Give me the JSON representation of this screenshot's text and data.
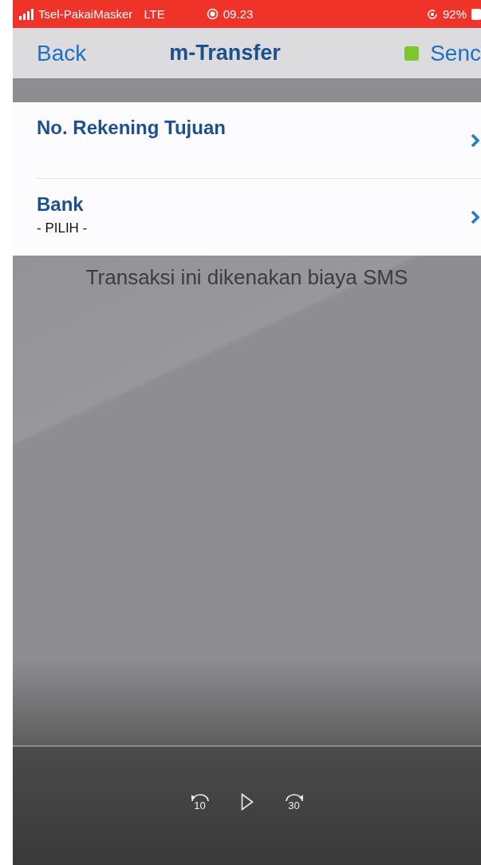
{
  "status_bar": {
    "carrier": "Tsel-PakaiMasker",
    "network": "LTE",
    "recording": true,
    "time": "09.23",
    "battery": "92%"
  },
  "nav_bar": {
    "back": "Back",
    "title": "m-Transfer",
    "action": "Senc"
  },
  "rows": [
    {
      "label": "No. Rekening Tujuan"
    },
    {
      "label": "Bank",
      "value": "- PILIH -"
    }
  ],
  "note": "Transaksi ini dikenakan biaya SMS",
  "player": {
    "rewind": "10",
    "forward": "30",
    "playing": false
  }
}
